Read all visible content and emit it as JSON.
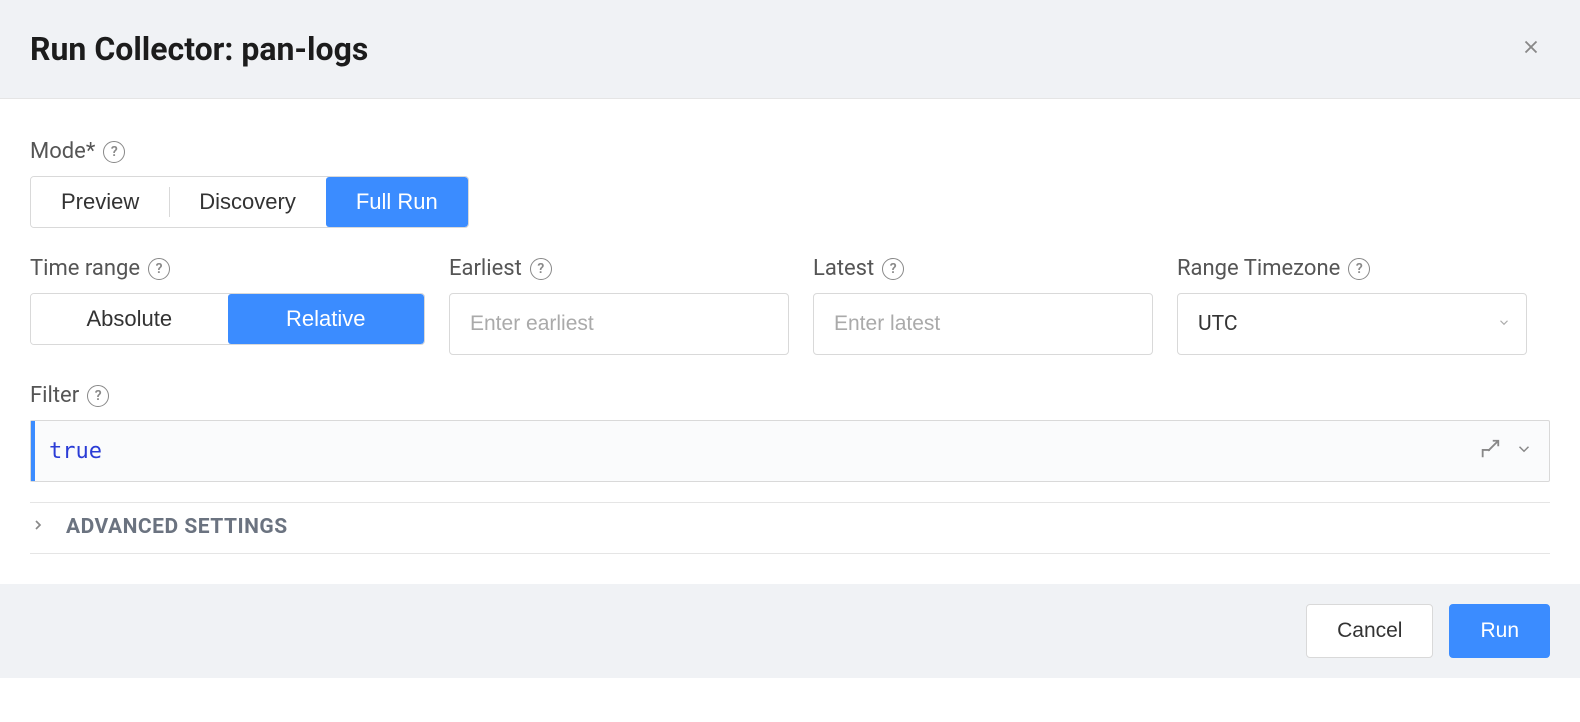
{
  "header": {
    "title": "Run Collector: pan-logs"
  },
  "mode": {
    "label": "Mode*",
    "options": [
      "Preview",
      "Discovery",
      "Full Run"
    ],
    "selected": "Full Run"
  },
  "timerange": {
    "label": "Time range",
    "options": [
      "Absolute",
      "Relative"
    ],
    "selected": "Relative"
  },
  "earliest": {
    "label": "Earliest",
    "placeholder": "Enter earliest",
    "value": ""
  },
  "latest": {
    "label": "Latest",
    "placeholder": "Enter latest",
    "value": ""
  },
  "timezone": {
    "label": "Range Timezone",
    "value": "UTC"
  },
  "filter": {
    "label": "Filter",
    "value": "true"
  },
  "advanced": {
    "label": "ADVANCED SETTINGS"
  },
  "footer": {
    "cancel": "Cancel",
    "run": "Run"
  }
}
